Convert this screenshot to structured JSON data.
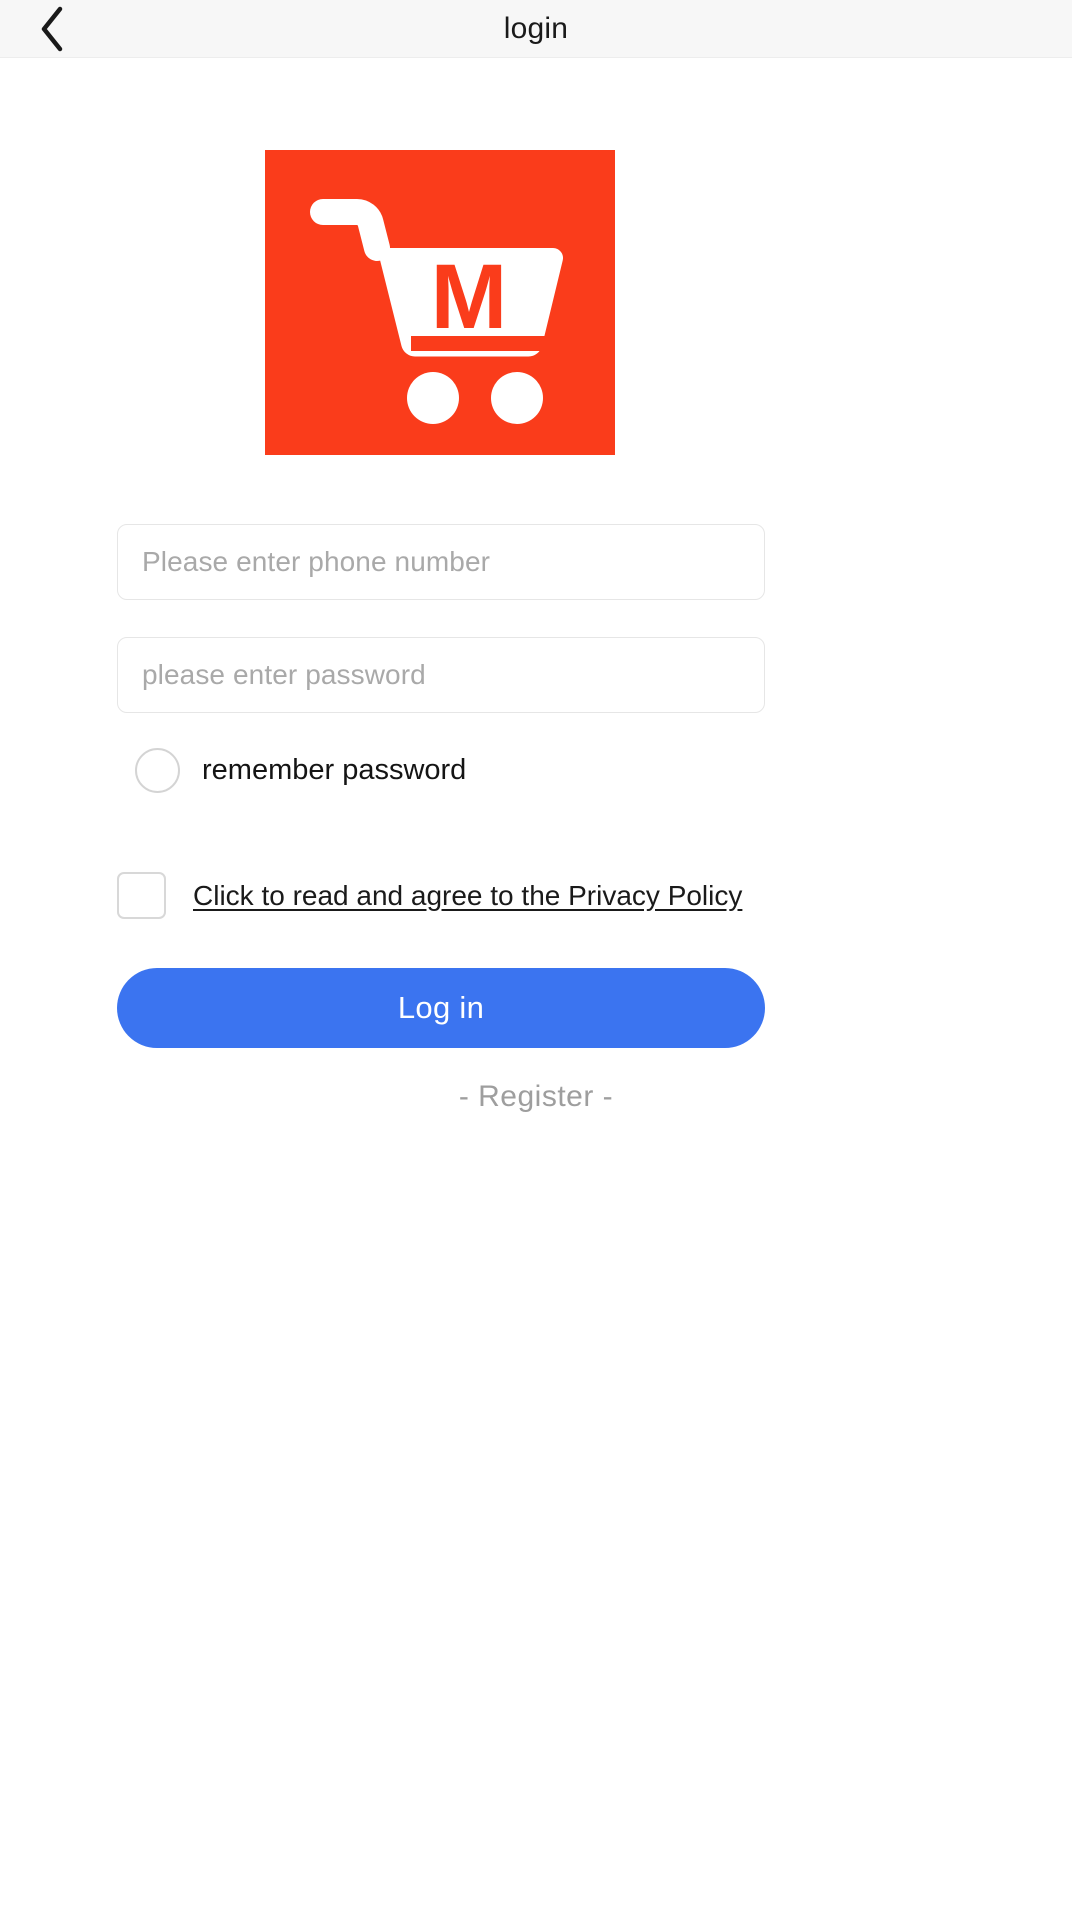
{
  "header": {
    "title": "login",
    "back_icon": "chevron-left-icon"
  },
  "logo": {
    "icon": "shopping-cart-logo",
    "letter": "M",
    "background_color": "#fa3c1b",
    "foreground_color": "#ffffff"
  },
  "form": {
    "phone": {
      "placeholder": "Please enter phone number",
      "value": ""
    },
    "password": {
      "placeholder": "please enter password",
      "value": ""
    },
    "remember": {
      "label": "remember password",
      "checked": false,
      "icon": "radio-circle-icon"
    },
    "privacy": {
      "label": "Click to read and agree to the Privacy Policy",
      "checked": false,
      "icon": "checkbox-square-icon"
    },
    "login_button": {
      "label": "Log in",
      "color": "#3b74f0",
      "text_color": "#ffffff"
    },
    "register_link": {
      "label": "- Register -",
      "color": "#9e9e9e"
    }
  },
  "colors": {
    "brand_red": "#fa3c1b",
    "accent_blue": "#3b74f0",
    "header_bg": "#f7f7f7",
    "placeholder_gray": "#a9a9a9",
    "border_gray": "#e6e6e6"
  }
}
